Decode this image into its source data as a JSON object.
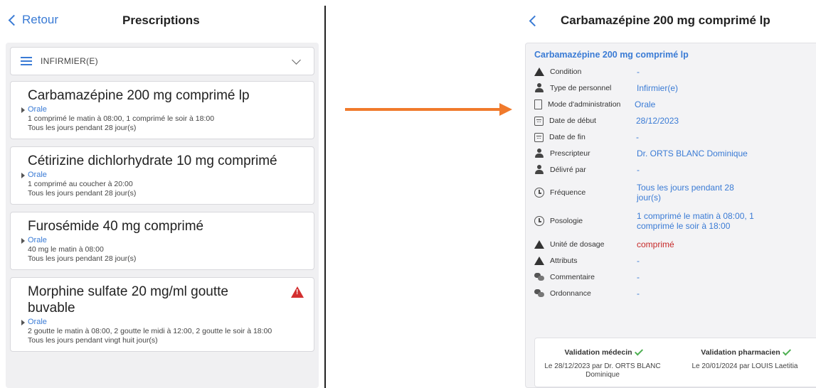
{
  "left": {
    "back_label": "Retour",
    "title": "Prescriptions",
    "filter_label": "INFIRMIER(E)",
    "medications": [
      {
        "name": "Carbamazépine 200 mg comprimé lp",
        "route": "Orale",
        "dosage": "1 comprimé le matin à 08:00, 1 comprimé le soir à 18:00",
        "frequency": "Tous les jours pendant 28 jour(s)",
        "alert": false
      },
      {
        "name": "Cétirizine dichlorhydrate 10 mg comprimé",
        "route": "Orale",
        "dosage": "1 comprimé au coucher à 20:00",
        "frequency": "Tous les jours pendant 28 jour(s)",
        "alert": false
      },
      {
        "name": "Furosémide 40 mg comprimé",
        "route": "Orale",
        "dosage": "40 mg le matin à 08:00",
        "frequency": "Tous les jours pendant 28 jour(s)",
        "alert": false
      },
      {
        "name": "Morphine sulfate 20 mg/ml goutte buvable",
        "route": "Orale",
        "dosage": "2 goutte le matin à 08:00, 2 goutte le midi à 12:00, 2 goutte le soir à 18:00",
        "frequency": "Tous les jours pendant vingt huit jour(s)",
        "alert": true
      }
    ]
  },
  "right": {
    "title": "Carbamazépine 200 mg comprimé lp",
    "drug_name": "Carbamazépine 200 mg comprimé lp",
    "details": [
      {
        "icon": "warning-icon",
        "label": "Condition",
        "value": "-"
      },
      {
        "icon": "person-icon",
        "label": "Type de personnel",
        "value": "Infirmier(e)"
      },
      {
        "icon": "document-icon",
        "label": "Mode d'administration",
        "value": "Orale"
      },
      {
        "icon": "calendar-icon",
        "label": "Date de début",
        "value": "28/12/2023"
      },
      {
        "icon": "calendar-icon",
        "label": "Date de fin",
        "value": "-"
      },
      {
        "icon": "doctor-icon",
        "label": "Prescripteur",
        "value": "Dr. ORTS BLANC Dominique"
      },
      {
        "icon": "person-icon",
        "label": "Délivré par",
        "value": "-"
      },
      {
        "icon": "clock-icon",
        "label": "Fréquence",
        "value": "Tous les jours pendant 28 jour(s)"
      },
      {
        "icon": "clock-icon",
        "label": "Posologie",
        "value": "1 comprimé le matin à 08:00, 1 comprimé le soir à 18:00"
      },
      {
        "icon": "warning-icon",
        "label": "Unité de dosage",
        "value": "comprimé"
      },
      {
        "icon": "warning-icon",
        "label": "Attributs",
        "value": "-"
      },
      {
        "icon": "comment-icon",
        "label": "Commentaire",
        "value": "-"
      },
      {
        "icon": "comment-icon",
        "label": "Ordonnance",
        "value": "-"
      }
    ],
    "validation": {
      "doctor_title": "Validation médecin",
      "doctor_text": "Le 28/12/2023 par Dr. ORTS BLANC Dominique",
      "pharmacist_title": "Validation pharmacien",
      "pharmacist_text": "Le 20/01/2024 par LOUIS Laetitia"
    }
  },
  "colors": {
    "accent": "#3a7bd5",
    "arrow": "#f07a2c",
    "alert": "#d32f2f",
    "check": "#4caf50"
  }
}
